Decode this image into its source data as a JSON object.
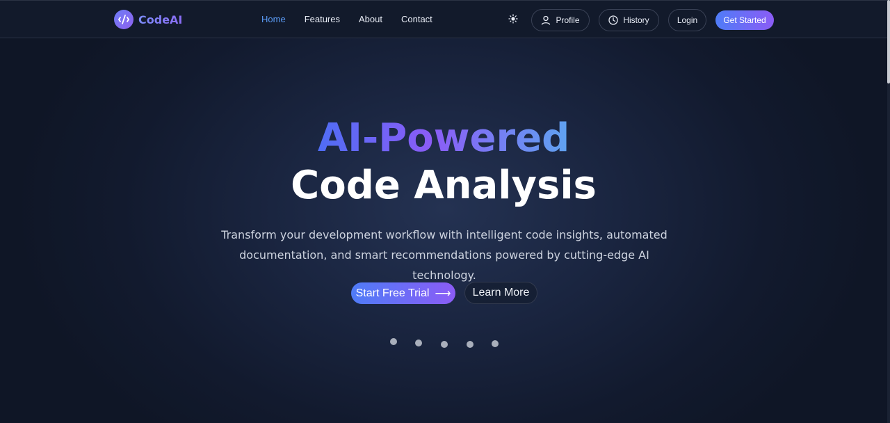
{
  "brand": {
    "name": "CodeAI",
    "logo_icon": "code-logo-icon"
  },
  "nav": {
    "links": [
      {
        "label": "Home",
        "active": true
      },
      {
        "label": "Features",
        "active": false
      },
      {
        "label": "About",
        "active": false
      },
      {
        "label": "Contact",
        "active": false
      }
    ],
    "theme_icon": "sun-icon",
    "profile_label": "Profile",
    "history_label": "History",
    "login_label": "Login",
    "cta_label": "Get Started"
  },
  "hero": {
    "title_line1": "AI-Powered",
    "title_line2": "Code Analysis",
    "subtitle_line1": "Transform your development workflow with intelligent code insights, automated",
    "subtitle_line2": "documentation, and smart recommendations powered by cutting-edge AI technology.",
    "primary_button": "Start Free Trial",
    "primary_icon": "arrow-right-icon",
    "secondary_button": "Learn More",
    "dots_count": 5
  },
  "colors": {
    "background": "#111729",
    "accent_blue": "#4f7cf7",
    "accent_purple": "#8b5cf6",
    "active_link": "#5b9bf5"
  }
}
